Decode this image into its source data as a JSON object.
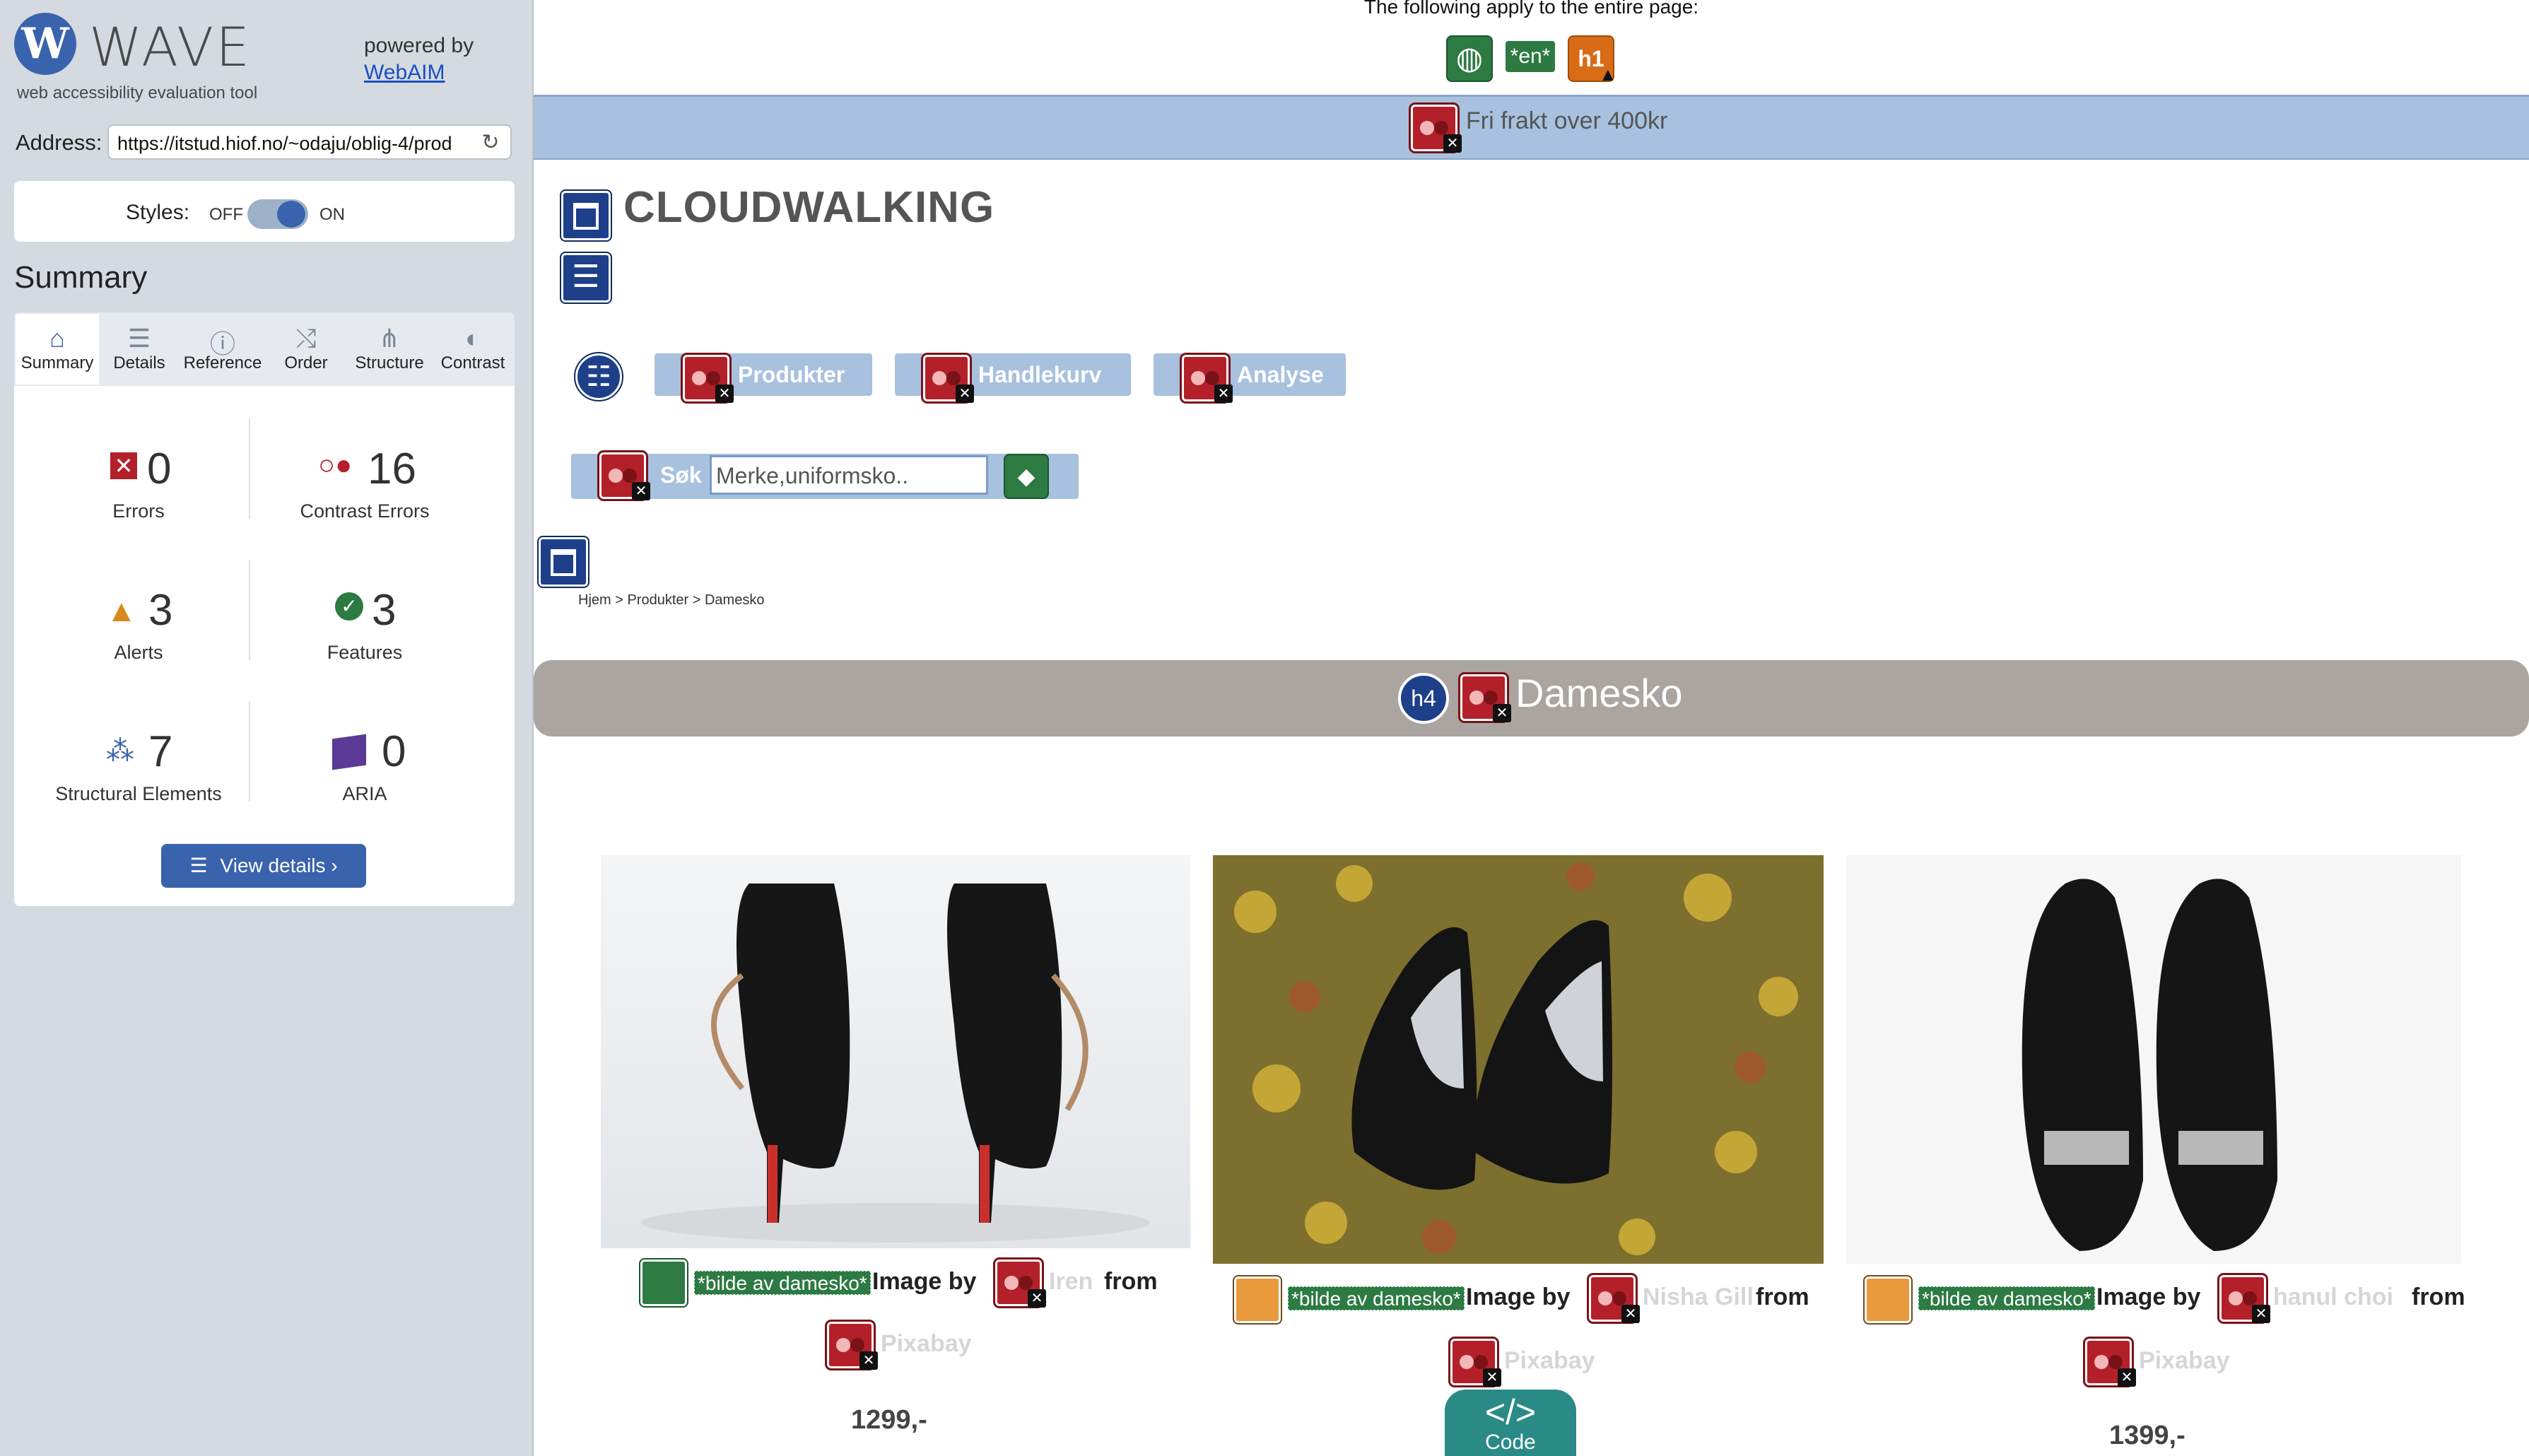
{
  "sidebar": {
    "logo_letter": "W",
    "logo_text": "WAVE",
    "logo_subtitle": "web accessibility evaluation tool",
    "powered_by": "powered by",
    "webaim_link": "WebAIM",
    "address_label": "Address:",
    "address_value": "https://itstud.hiof.no/~odaju/oblig-4/prod",
    "styles_label": "Styles:",
    "styles_off": "OFF",
    "styles_on": "ON",
    "summary_title": "Summary",
    "tabs": [
      {
        "label": "Summary",
        "icon": "home-icon"
      },
      {
        "label": "Details",
        "icon": "list-icon"
      },
      {
        "label": "Reference",
        "icon": "info-icon"
      },
      {
        "label": "Order",
        "icon": "order-icon"
      },
      {
        "label": "Structure",
        "icon": "structure-icon"
      },
      {
        "label": "Contrast",
        "icon": "contrast-icon"
      }
    ],
    "stats": {
      "errors": {
        "value": "0",
        "label": "Errors"
      },
      "contrast_errors": {
        "value": "16",
        "label": "Contrast Errors"
      },
      "alerts": {
        "value": "3",
        "label": "Alerts"
      },
      "features": {
        "value": "3",
        "label": "Features"
      },
      "structural": {
        "value": "7",
        "label": "Structural Elements"
      },
      "aria": {
        "value": "0",
        "label": "ARIA"
      }
    },
    "view_details": "View details ›"
  },
  "page": {
    "top_text": "The following apply to the entire page:",
    "lang_badge": "*en*",
    "h1_badge": "h1",
    "banner_text": "Fri frakt over 400kr",
    "brand": "CLOUDWALKING",
    "nav": [
      "Produkter",
      "Handlekurv",
      "Analyse"
    ],
    "search_label": "Søk",
    "search_placeholder": "Merke,uniformsko..",
    "breadcrumb": "Hjem > Produkter > Damesko",
    "h4_badge": "h4",
    "heading": "Damesko",
    "products": [
      {
        "alt": "*bilde av damesko*",
        "image_by": "Image by",
        "author": "Iren",
        "from": "from",
        "source": "Pixabay",
        "price": "1299,-"
      },
      {
        "alt": "*bilde av damesko*",
        "image_by": "Image by",
        "author": "Nisha Gill",
        "from": "from",
        "source": "Pixabay",
        "price": ""
      },
      {
        "alt": "*bilde av damesko*",
        "image_by": "Image by",
        "author": "hanul choi",
        "from": "from",
        "source": "Pixabay",
        "price": "1399,-"
      }
    ],
    "code_button": "Code",
    "code_glyph": "</>"
  },
  "colors": {
    "wave_blue": "#3a63ad",
    "sidebar_bg": "#d5dae0",
    "banner_bg": "#a7c1df",
    "heading_bar": "#aaa5a0",
    "contrast_red": "#b3202a",
    "feature_green": "#2d7a42",
    "alert_orange": "#d86b16"
  }
}
